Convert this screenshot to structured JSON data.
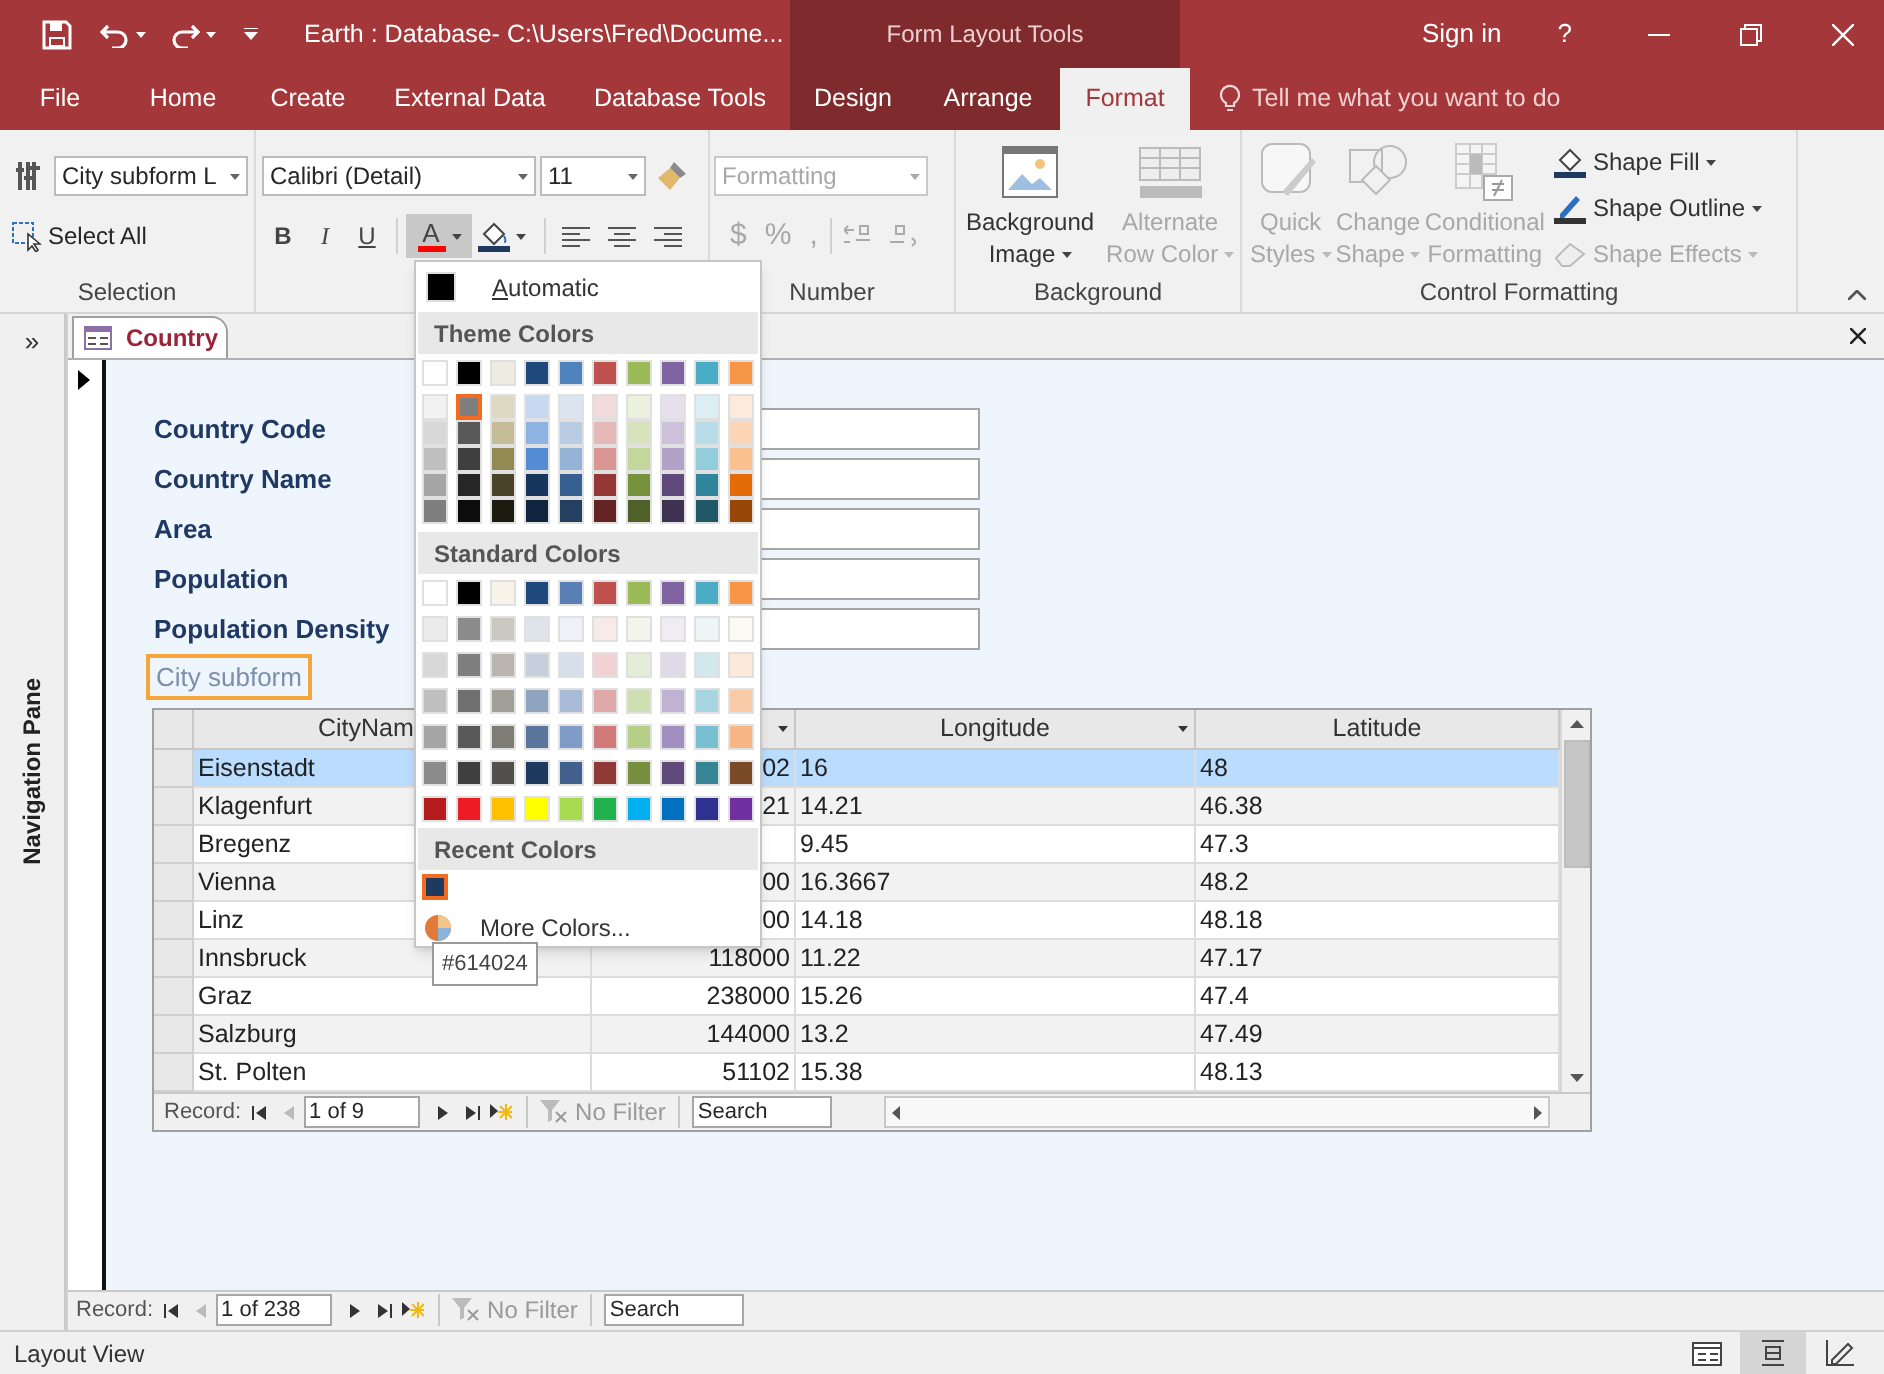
{
  "title_bar": {
    "title": "Earth : Database- C:\\Users\\Fred\\Docume...",
    "context_title": "Form Layout Tools",
    "sign_in": "Sign in",
    "help": "?"
  },
  "ribbon_tabs": [
    {
      "label": "File",
      "contextual": false,
      "selected": false
    },
    {
      "label": "Home",
      "contextual": false,
      "selected": false
    },
    {
      "label": "Create",
      "contextual": false,
      "selected": false
    },
    {
      "label": "External Data",
      "contextual": false,
      "selected": false
    },
    {
      "label": "Database Tools",
      "contextual": false,
      "selected": false
    },
    {
      "label": "Design",
      "contextual": true,
      "selected": false
    },
    {
      "label": "Arrange",
      "contextual": true,
      "selected": false
    },
    {
      "label": "Format",
      "contextual": true,
      "selected": true
    }
  ],
  "tell_me": "Tell me what you want to do",
  "selection_group": {
    "label": "Selection",
    "object_combo": "City subform L",
    "select_all": "Select All"
  },
  "font_group": {
    "font": "Calibri (Detail)",
    "size": "11",
    "style_buttons": [
      "B",
      "I",
      "U"
    ],
    "font_color_glyph": "A",
    "font_color_open": true
  },
  "number_group": {
    "label": "Number",
    "format_combo": "Formatting",
    "symbols": [
      "$",
      "%",
      ","
    ],
    "disabled": true
  },
  "background_group": {
    "label": "Background",
    "buttons": [
      {
        "lines": [
          "Background",
          "Image"
        ],
        "disabled": false
      },
      {
        "lines": [
          "Alternate",
          "Row Color"
        ],
        "disabled": true
      }
    ]
  },
  "control_formatting": {
    "label": "Control Formatting",
    "big_buttons": [
      {
        "lines": [
          "Quick",
          "Styles"
        ],
        "disabled": true
      },
      {
        "lines": [
          "Change",
          "Shape"
        ],
        "disabled": true
      },
      {
        "lines": [
          "Conditional",
          "Formatting"
        ],
        "disabled": true
      }
    ],
    "small_buttons": [
      {
        "label": "Shape Fill",
        "disabled": false
      },
      {
        "label": "Shape Outline",
        "disabled": false
      },
      {
        "label": "Shape Effects",
        "disabled": true
      }
    ]
  },
  "nav_pane": {
    "toggle": "»",
    "label": "Navigation Pane"
  },
  "document_tab": {
    "label": "Country",
    "selected": true
  },
  "form": {
    "fields": [
      "Country Code",
      "Country Name",
      "Area",
      "Population",
      "Population Density"
    ],
    "subform_label": "City subform",
    "subform_selected": true
  },
  "subform": {
    "columns": [
      {
        "label": "CityNam"
      },
      {
        "filter_arrow": true
      },
      {
        "label": "Longitude",
        "filter_arrow": true
      },
      {
        "label": "Latitude",
        "filter_arrow": false
      }
    ],
    "rows": [
      {
        "city": "Eisenstadt",
        "population": "02",
        "longitude": "16",
        "latitude": "48",
        "selected": true
      },
      {
        "city": "Klagenfurt",
        "population": "21",
        "longitude": "14.21",
        "latitude": "46.38",
        "selected": false
      },
      {
        "city": "Bregenz",
        "longitude": "9.45",
        "latitude": "47.3",
        "selected": false
      },
      {
        "city": "Vienna",
        "population": "00",
        "longitude": "16.3667",
        "latitude": "48.2",
        "selected": false
      },
      {
        "city": "Linz",
        "population": "00",
        "longitude": "14.18",
        "latitude": "48.18",
        "selected": false
      },
      {
        "city": "Innsbruck",
        "population": "118000",
        "longitude": "11.22",
        "latitude": "47.17",
        "selected": false
      },
      {
        "city": "Graz",
        "population": "238000",
        "longitude": "15.26",
        "latitude": "47.4",
        "selected": false
      },
      {
        "city": "Salzburg",
        "population": "144000",
        "longitude": "13.2",
        "latitude": "47.49",
        "selected": false
      },
      {
        "city": "St. Polten",
        "population": "51102",
        "longitude": "15.38",
        "latitude": "48.13",
        "selected": false
      }
    ],
    "navigation": {
      "label": "Record:",
      "position": "1 of 9",
      "filter": "No Filter",
      "search": "Search"
    }
  },
  "record_navigation": {
    "label": "Record:",
    "position": "1 of 238",
    "filter": "No Filter",
    "search": "Search"
  },
  "status_bar": {
    "view": "Layout View",
    "view_buttons": [
      {
        "kind": "form",
        "selected": false
      },
      {
        "kind": "layout",
        "selected": true
      },
      {
        "kind": "design",
        "selected": false
      }
    ]
  },
  "color_menu": {
    "automatic": "Automatic",
    "theme_heading": "Theme Colors",
    "theme_row": [
      {
        "color": "#ffffff",
        "selected": false
      },
      {
        "color": "#000000",
        "selected": false
      },
      {
        "color": "#eeece1",
        "selected": false
      },
      {
        "color": "#1f497d",
        "selected": false
      },
      {
        "color": "#4f81bd",
        "selected": false
      },
      {
        "color": "#c0504d",
        "selected": false
      },
      {
        "color": "#9bbb59",
        "selected": false
      },
      {
        "color": "#8064a2",
        "selected": false
      },
      {
        "color": "#4bacc6",
        "selected": false
      },
      {
        "color": "#f79646",
        "selected": false
      }
    ],
    "theme_shades": [
      [
        {
          "color": "#f2f2f2",
          "selected": false
        },
        {
          "color": "#7f7f7f",
          "selected": true
        },
        {
          "color": "#ddd9c3",
          "selected": false
        },
        {
          "color": "#c6d9f0",
          "selected": false
        },
        {
          "color": "#dbe5f1",
          "selected": false
        },
        {
          "color": "#f2dcdb",
          "selected": false
        },
        {
          "color": "#ebf1dd",
          "selected": false
        },
        {
          "color": "#e5e0ec",
          "selected": false
        },
        {
          "color": "#dbeef3",
          "selected": false
        },
        {
          "color": "#fdeada",
          "selected": false
        }
      ],
      [
        {
          "color": "#d8d8d8",
          "selected": false
        },
        {
          "color": "#595959",
          "selected": false
        },
        {
          "color": "#c4bd97",
          "selected": false
        },
        {
          "color": "#8db3e2",
          "selected": false
        },
        {
          "color": "#b8cce4",
          "selected": false
        },
        {
          "color": "#e5b9b7",
          "selected": false
        },
        {
          "color": "#d7e3bc",
          "selected": false
        },
        {
          "color": "#ccc1d9",
          "selected": false
        },
        {
          "color": "#b7dde8",
          "selected": false
        },
        {
          "color": "#fbd5b5",
          "selected": false
        }
      ],
      [
        {
          "color": "#bfbfbf",
          "selected": false
        },
        {
          "color": "#3f3f3f",
          "selected": false
        },
        {
          "color": "#938953",
          "selected": false
        },
        {
          "color": "#548dd4",
          "selected": false
        },
        {
          "color": "#95b3d7",
          "selected": false
        },
        {
          "color": "#d99694",
          "selected": false
        },
        {
          "color": "#c3d69b",
          "selected": false
        },
        {
          "color": "#b2a2c7",
          "selected": false
        },
        {
          "color": "#92cddc",
          "selected": false
        },
        {
          "color": "#fac08f",
          "selected": false
        }
      ],
      [
        {
          "color": "#a5a5a5",
          "selected": false
        },
        {
          "color": "#262626",
          "selected": false
        },
        {
          "color": "#494429",
          "selected": false
        },
        {
          "color": "#17365d",
          "selected": false
        },
        {
          "color": "#366092",
          "selected": false
        },
        {
          "color": "#953734",
          "selected": false
        },
        {
          "color": "#76923c",
          "selected": false
        },
        {
          "color": "#5f497a",
          "selected": false
        },
        {
          "color": "#31859b",
          "selected": false
        },
        {
          "color": "#e36c09",
          "selected": false
        }
      ],
      [
        {
          "color": "#7f7f7f",
          "selected": false
        },
        {
          "color": "#0c0c0c",
          "selected": false
        },
        {
          "color": "#1d1b10",
          "selected": false
        },
        {
          "color": "#0f243e",
          "selected": false
        },
        {
          "color": "#244061",
          "selected": false
        },
        {
          "color": "#632423",
          "selected": false
        },
        {
          "color": "#4f6128",
          "selected": false
        },
        {
          "color": "#3f3151",
          "selected": false
        },
        {
          "color": "#205867",
          "selected": false
        },
        {
          "color": "#974806",
          "selected": false
        }
      ]
    ],
    "standard_heading": "Standard Colors",
    "standard_rows": [
      [
        {
          "color": "#ffffff",
          "selected": false
        },
        {
          "color": "#000000",
          "selected": false
        },
        {
          "color": "#f8f3e8",
          "selected": false
        },
        {
          "color": "#1f497d",
          "selected": false
        },
        {
          "color": "#5a7fb5",
          "selected": false
        },
        {
          "color": "#c0504d",
          "selected": false
        },
        {
          "color": "#9bbb59",
          "selected": false
        },
        {
          "color": "#8064a2",
          "selected": false
        },
        {
          "color": "#4bacc6",
          "selected": false
        },
        {
          "color": "#f79646",
          "selected": false
        }
      ],
      [
        {
          "color": "#ebebeb",
          "selected": false
        },
        {
          "color": "#8c8c8c",
          "selected": false
        },
        {
          "color": "#cbc8c2",
          "selected": false
        },
        {
          "color": "#dfe3ea",
          "selected": false
        },
        {
          "color": "#eef1f6",
          "selected": false
        },
        {
          "color": "#f9eaea",
          "selected": false
        },
        {
          "color": "#f4f6ed",
          "selected": false
        },
        {
          "color": "#efedf3",
          "selected": false
        },
        {
          "color": "#edf5f7",
          "selected": false
        },
        {
          "color": "#fdfaf6",
          "selected": false
        }
      ],
      [
        {
          "color": "#d8d8d8",
          "selected": false
        },
        {
          "color": "#7f7f7f",
          "selected": false
        },
        {
          "color": "#b9b4ad",
          "selected": false
        },
        {
          "color": "#c5d0dc",
          "selected": false
        },
        {
          "color": "#d7dfeb",
          "selected": false
        },
        {
          "color": "#f1d2d3",
          "selected": false
        },
        {
          "color": "#e4edd8",
          "selected": false
        },
        {
          "color": "#dfdae7",
          "selected": false
        },
        {
          "color": "#d2e8ed",
          "selected": false
        },
        {
          "color": "#fde9d9",
          "selected": false
        }
      ],
      [
        {
          "color": "#bfbfbf",
          "selected": false
        },
        {
          "color": "#707070",
          "selected": false
        },
        {
          "color": "#a29e98",
          "selected": false
        },
        {
          "color": "#8ea3bd",
          "selected": false
        },
        {
          "color": "#a8bcd7",
          "selected": false
        },
        {
          "color": "#e0a9a9",
          "selected": false
        },
        {
          "color": "#cfdfb1",
          "selected": false
        },
        {
          "color": "#c0b2d2",
          "selected": false
        },
        {
          "color": "#a8d5e2",
          "selected": false
        },
        {
          "color": "#f8cba6",
          "selected": false
        }
      ],
      [
        {
          "color": "#a5a5a5",
          "selected": false
        },
        {
          "color": "#595959",
          "selected": false
        },
        {
          "color": "#7f7b75",
          "selected": false
        },
        {
          "color": "#59759c",
          "selected": false
        },
        {
          "color": "#7f9cc8",
          "selected": false
        },
        {
          "color": "#d27a7a",
          "selected": false
        },
        {
          "color": "#b6cf87",
          "selected": false
        },
        {
          "color": "#a28fc1",
          "selected": false
        },
        {
          "color": "#78bfd2",
          "selected": false
        },
        {
          "color": "#f6b584",
          "selected": false
        }
      ],
      [
        {
          "color": "#8c8c8c",
          "selected": false
        },
        {
          "color": "#3f3f3f",
          "selected": false
        },
        {
          "color": "#52504d",
          "selected": false
        },
        {
          "color": "#1e3a5f",
          "selected": false
        },
        {
          "color": "#42618e",
          "selected": false
        },
        {
          "color": "#8f3a37",
          "selected": false
        },
        {
          "color": "#77903f",
          "selected": false
        },
        {
          "color": "#604a7b",
          "selected": false
        },
        {
          "color": "#378494",
          "selected": false
        },
        {
          "color": "#7a4a27",
          "selected": false
        }
      ],
      [
        {
          "color": "#b71c1c",
          "selected": false
        },
        {
          "color": "#ed1c24",
          "selected": false
        },
        {
          "color": "#ffc000",
          "selected": false
        },
        {
          "color": "#ffff00",
          "selected": false
        },
        {
          "color": "#a8db4f",
          "selected": false
        },
        {
          "color": "#21b14d",
          "selected": false
        },
        {
          "color": "#00b0f0",
          "selected": false
        },
        {
          "color": "#0070c0",
          "selected": false
        },
        {
          "color": "#2e3192",
          "selected": false
        },
        {
          "color": "#7030a0",
          "selected": false
        }
      ]
    ],
    "recent_heading": "Recent Colors",
    "recent": [
      {
        "color": "#1f3a5f",
        "selected": true
      }
    ],
    "more_colors": "More Colors...",
    "tooltip": "#614024"
  }
}
